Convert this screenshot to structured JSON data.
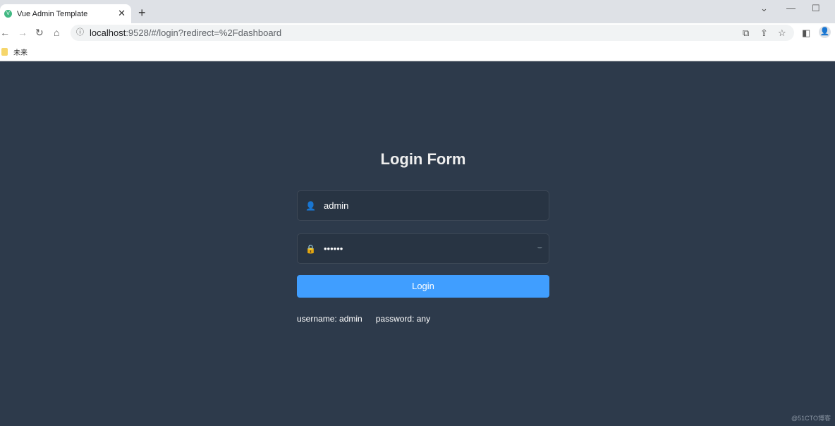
{
  "browser": {
    "tab_title": "Vue Admin Template",
    "favicon_letter": "V",
    "url_host": "localhost",
    "url_path": ":9528/#/login?redirect=%2Fdashboard",
    "bookmark": "未来"
  },
  "login": {
    "title": "Login Form",
    "username": "admin",
    "password_masked": "••••••",
    "button": "Login",
    "tip_username": "username: admin",
    "tip_password": "password: any"
  },
  "colors": {
    "background": "#2d3a4b",
    "button": "#409eff",
    "input_bg": "#283443"
  },
  "watermark": "@51CTO博客"
}
